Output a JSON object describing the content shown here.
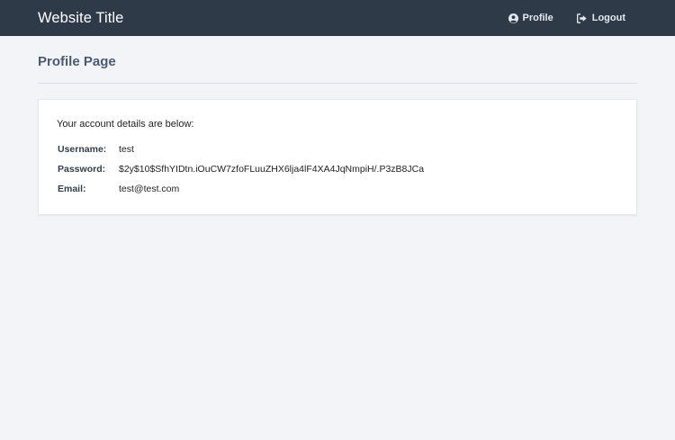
{
  "header": {
    "brand": "Website Title",
    "nav": {
      "profile": {
        "label": "Profile",
        "icon": "user-circle-icon"
      },
      "logout": {
        "label": "Logout",
        "icon": "sign-out-icon"
      }
    }
  },
  "page": {
    "title": "Profile Page",
    "intro": "Your account details are below:",
    "details": [
      {
        "label": "Username:",
        "value": "test"
      },
      {
        "label": "Password:",
        "value": "$2y$10$SfhYIDtn.iOuCW7zfoFLuuZHX6lja4lF4XA4JqNmpiH/.P3zB8JCa"
      },
      {
        "label": "Email:",
        "value": "test@test.com"
      }
    ]
  },
  "colors": {
    "navbar": "#2f3a48",
    "background": "#f3f4f8",
    "title": "#4a5a70"
  }
}
